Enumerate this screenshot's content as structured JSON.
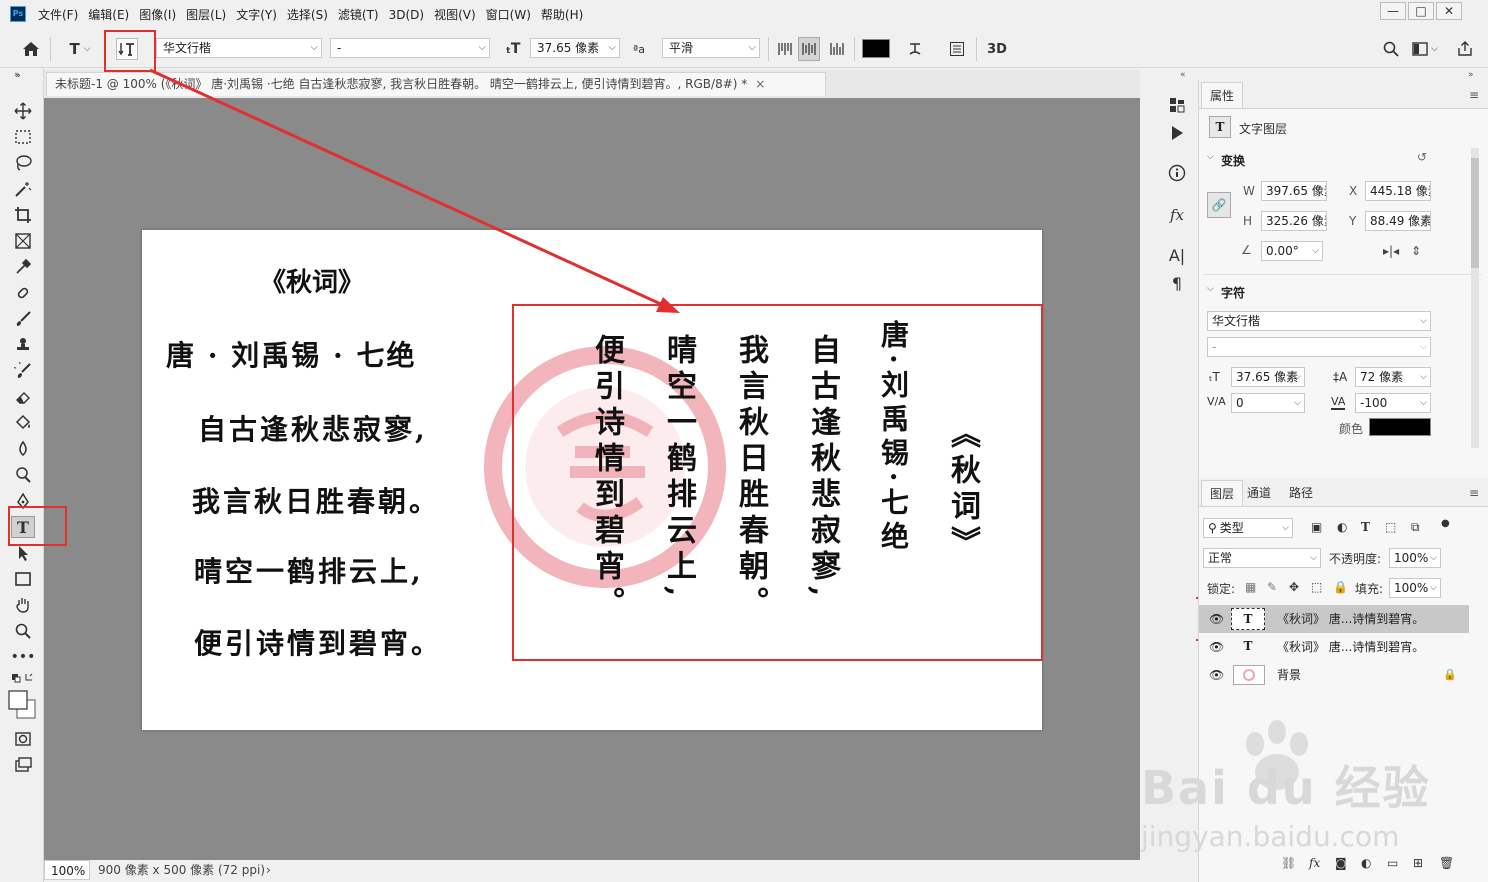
{
  "menubar": {
    "logo": "Ps",
    "items": [
      "文件(F)",
      "编辑(E)",
      "图像(I)",
      "图层(L)",
      "文字(Y)",
      "选择(S)",
      "滤镜(T)",
      "3D(D)",
      "视图(V)",
      "窗口(W)",
      "帮助(H)"
    ],
    "window_buttons": [
      "—",
      "□",
      "✕"
    ]
  },
  "options": {
    "font_family": "华文行楷",
    "font_style": "-",
    "font_size": "37.65 像素",
    "aa_label": "ªa",
    "antialias": "平滑",
    "btn_3d": "3D",
    "text_color": "#000000"
  },
  "document": {
    "tab_title": "未标题-1 @ 100% (《秋词》 唐·刘禹锡 ·七绝 自古逢秋悲寂寥, 我言秋日胜春朝。 晴空一鹤排云上, 便引诗情到碧宵。, RGB/8#) *",
    "tab_close": "×",
    "zoom": "100%",
    "doc_info": "900 像素 x 500 像素 (72 ppi)",
    "status_arrow": "›"
  },
  "canvas_text": {
    "left_title": "《秋词》",
    "left_lines": [
      "唐 · 刘禹锡 · 七绝",
      "自古逢秋悲寂寥,",
      "我言秋日胜春朝。",
      "晴空一鹤排云上,",
      "便引诗情到碧宵。"
    ],
    "vertical_columns": [
      "《秋词》",
      "唐·刘禹锡·七绝",
      "自古逢秋悲寂寥,",
      "我言秋日胜春朝。",
      "晴空一鹤排云上,",
      "便引诗情到碧宵。"
    ]
  },
  "properties": {
    "tab": "属性",
    "layer_kind": "文字图层",
    "transform_title": "变换",
    "w_label": "W",
    "w_value": "397.65 像素",
    "x_label": "X",
    "x_value": "445.18 像素",
    "h_label": "H",
    "h_value": "325.26 像素",
    "y_label": "Y",
    "y_value": "88.49 像素",
    "angle_value": "0.00°",
    "char_title": "字符",
    "char_font": "华文行楷",
    "char_style": "-",
    "char_size": "37.65 像素",
    "char_leading": "72 像素",
    "char_kerning": "0",
    "char_tracking": "-100",
    "color_label": "颜色",
    "color_value": "#000000"
  },
  "layers": {
    "tabs": [
      "图层",
      "通道",
      "路径"
    ],
    "filter_kind": "类型",
    "blend_mode": "正常",
    "opacity_label": "不透明度:",
    "opacity_value": "100%",
    "lock_label": "锁定:",
    "fill_label": "填充:",
    "fill_value": "100%",
    "rows": [
      {
        "name": "《秋词》 唐...诗情到碧宵。",
        "type": "T"
      },
      {
        "name": "《秋词》 唐...诗情到碧宵。",
        "type": "T"
      },
      {
        "name": "背景",
        "type": "bg"
      }
    ]
  },
  "watermark": {
    "brand": "Bai du 经验",
    "url": "jingyan.baidu.com"
  },
  "colors": {
    "annotation_red": "#e03030",
    "accent_blue": "#31a8ff",
    "seal_pink": "#f0a8b0"
  }
}
